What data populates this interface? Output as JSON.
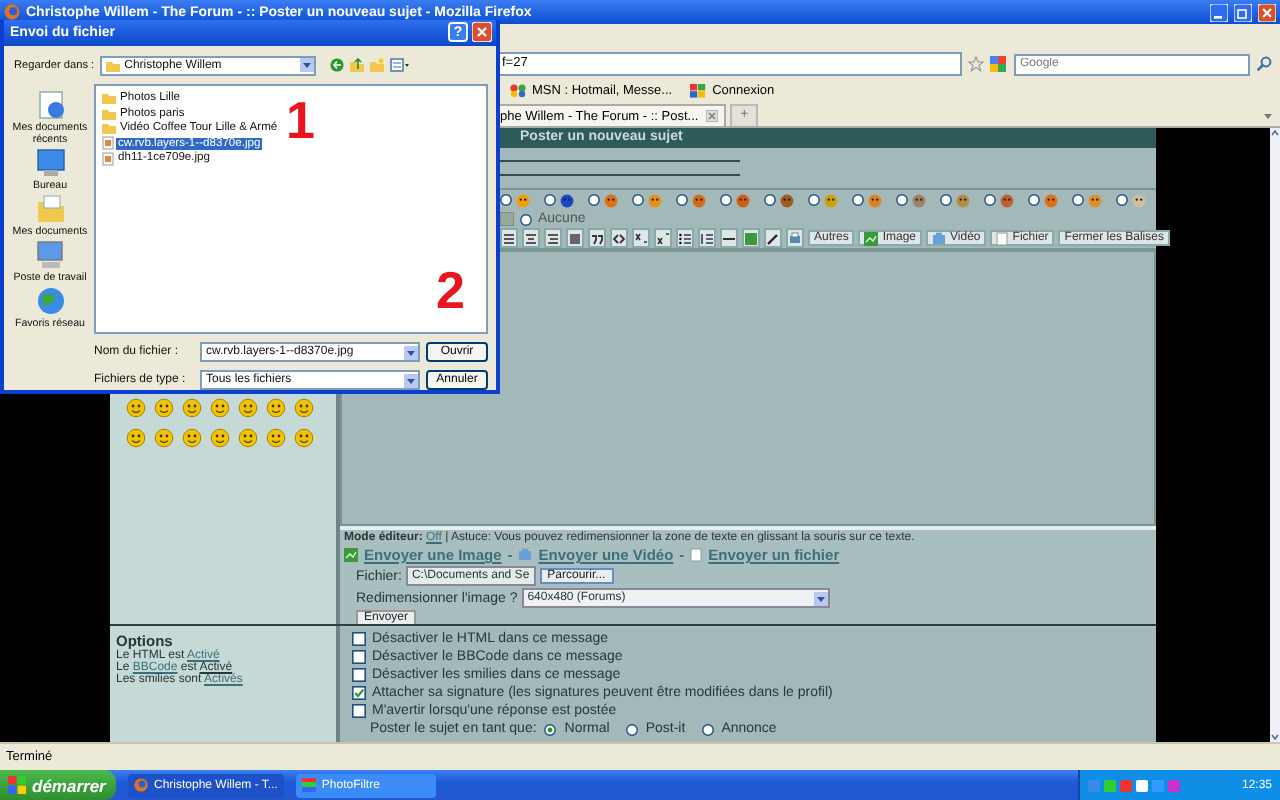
{
  "browser": {
    "title": "Christophe Willem - The Forum - :: Poster un nouveau sujet - Mozilla Firefox",
    "address": "f=27",
    "search_placeholder": "Google",
    "bookmarks": [
      "MSN : Hotmail, Messe...",
      "Connexion"
    ],
    "tab": "phe Willem - The Forum - :: Post...",
    "new_tab": "+",
    "status": "Terminé"
  },
  "forum": {
    "header": "Poster un nouveau sujet",
    "post_icons": [
      {
        "selected": false
      },
      {
        "selected": false
      },
      {
        "selected": false
      },
      {
        "selected": false
      },
      {
        "selected": false
      },
      {
        "selected": false
      },
      {
        "selected": false
      },
      {
        "selected": false
      },
      {
        "selected": false
      },
      {
        "selected": false
      },
      {
        "selected": false
      },
      {
        "selected": false
      },
      {
        "selected": false
      },
      {
        "selected": false
      },
      {
        "selected": false
      }
    ],
    "no_icon": {
      "label": "Aucune",
      "selected": false
    },
    "toolbar_buttons": [
      {
        "label": "Autres",
        "kind": "plain"
      },
      {
        "label": "Image",
        "kind": "image"
      },
      {
        "label": "Vidéo",
        "kind": "video"
      },
      {
        "label": "Fichier",
        "kind": "file"
      },
      {
        "label": "Fermer les Balises",
        "kind": "plain"
      }
    ],
    "editor_mode": {
      "label": "Mode éditeur:",
      "link": "Off",
      "tip": "| Astuce: Vous pouvez redimensionner la zone de texte en glissant la souris sur ce texte."
    },
    "upload_links": [
      {
        "label": "Envoyer une Image",
        "kind": "image",
        "separator": "-"
      },
      {
        "label": "Envoyer une Vidéo",
        "kind": "video",
        "separator": "-"
      },
      {
        "label": "Envoyer un fichier",
        "kind": "file"
      }
    ],
    "file_label": "Fichier:",
    "file_value": "C:\\Documents and Se",
    "browse": "Parcourir...",
    "resize_label": "Redimensionner l'image ?",
    "resize_value": "640x480 (Forums)",
    "send": "Envoyer",
    "options": {
      "title": "Options",
      "status_lines": [
        [
          {
            "kind": "text",
            "text": "Le HTML est"
          },
          {
            "kind": "link",
            "text": "Activé"
          }
        ],
        [
          {
            "kind": "text",
            "text": "Le"
          },
          {
            "kind": "link",
            "text": "BBCode"
          },
          {
            "kind": "text",
            "text": "est"
          },
          {
            "kind": "link",
            "text": "Activé"
          }
        ],
        [
          {
            "kind": "text",
            "text": "Les smilies sont"
          },
          {
            "kind": "link",
            "text": "Activés"
          }
        ]
      ],
      "checkboxes": [
        {
          "label": "Désactiver le HTML dans ce message",
          "checked": false
        },
        {
          "label": "Désactiver le BBCode dans ce message",
          "checked": false
        },
        {
          "label": "Désactiver les smilies dans ce message",
          "checked": false
        },
        {
          "label": "Attacher sa signature (les signatures peuvent être modifiées dans le profil)",
          "checked": true
        },
        {
          "label": "M'avertir lorsqu'une réponse est postée",
          "checked": false
        }
      ],
      "post_as": {
        "label": "Poster le sujet en tant que:",
        "choices": [
          {
            "label": "Normal",
            "selected": true
          },
          {
            "label": "Post-it",
            "selected": false
          },
          {
            "label": "Annonce",
            "selected": false
          }
        ]
      }
    }
  },
  "dialog": {
    "title": "Envoi du fichier",
    "help": "?",
    "look_in_label": "Regarder dans :",
    "look_in_value": "Christophe Willem",
    "places": [
      {
        "label": "Mes documents récents",
        "kind": "recent"
      },
      {
        "label": "Bureau",
        "kind": "desktop"
      },
      {
        "label": "Mes documents",
        "kind": "documents"
      },
      {
        "label": "Poste de travail",
        "kind": "computer"
      },
      {
        "label": "Favoris réseau",
        "kind": "network"
      }
    ],
    "files": [
      {
        "name": "Photos Lille",
        "kind": "folder",
        "selected": false
      },
      {
        "name": "Photos paris",
        "kind": "folder",
        "selected": false
      },
      {
        "name": "Vidéo Coffee Tour Lille & Armé",
        "kind": "folder",
        "selected": false
      },
      {
        "name": "cw.rvb.layers-1--d8370e.jpg",
        "kind": "image",
        "selected": true
      },
      {
        "name": "dh11-1ce709e.jpg",
        "kind": "image",
        "selected": false
      }
    ],
    "filename_label": "Nom du fichier :",
    "filename_value": "cw.rvb.layers-1--d8370e.jpg",
    "filetype_label": "Fichiers de type :",
    "filetype_value": "Tous les fichiers",
    "buttons": [
      "Ouvrir",
      "Annuler"
    ],
    "annotations": [
      "1",
      "2"
    ]
  },
  "taskbar": {
    "start": "démarrer",
    "tasks": [
      {
        "label": "Christophe Willem - T...",
        "selected": false
      },
      {
        "label": "PhotoFiltre",
        "selected": true
      }
    ],
    "clock": "12:35"
  }
}
